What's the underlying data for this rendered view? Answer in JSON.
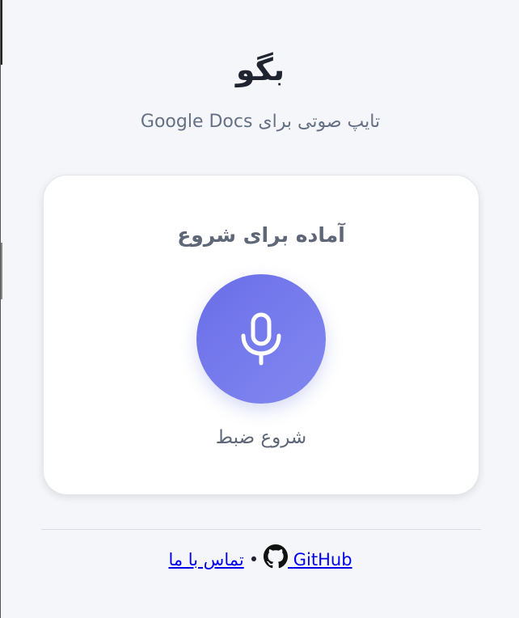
{
  "header": {
    "title": "بگو",
    "subtitle": "تایپ صوتی برای Google Docs"
  },
  "card": {
    "status": "آماده برای شروع",
    "record_label": "شروع ضبط",
    "mic_icon": "microphone-icon"
  },
  "footer": {
    "github_label": "GitHub",
    "github_icon": "github-icon",
    "separator": "•",
    "contact_label": "تماس با ما"
  },
  "colors": {
    "background": "#f4f6fa",
    "accent_start": "#6a6ee8",
    "accent_end": "#8288f0",
    "link": "#0000ee"
  }
}
